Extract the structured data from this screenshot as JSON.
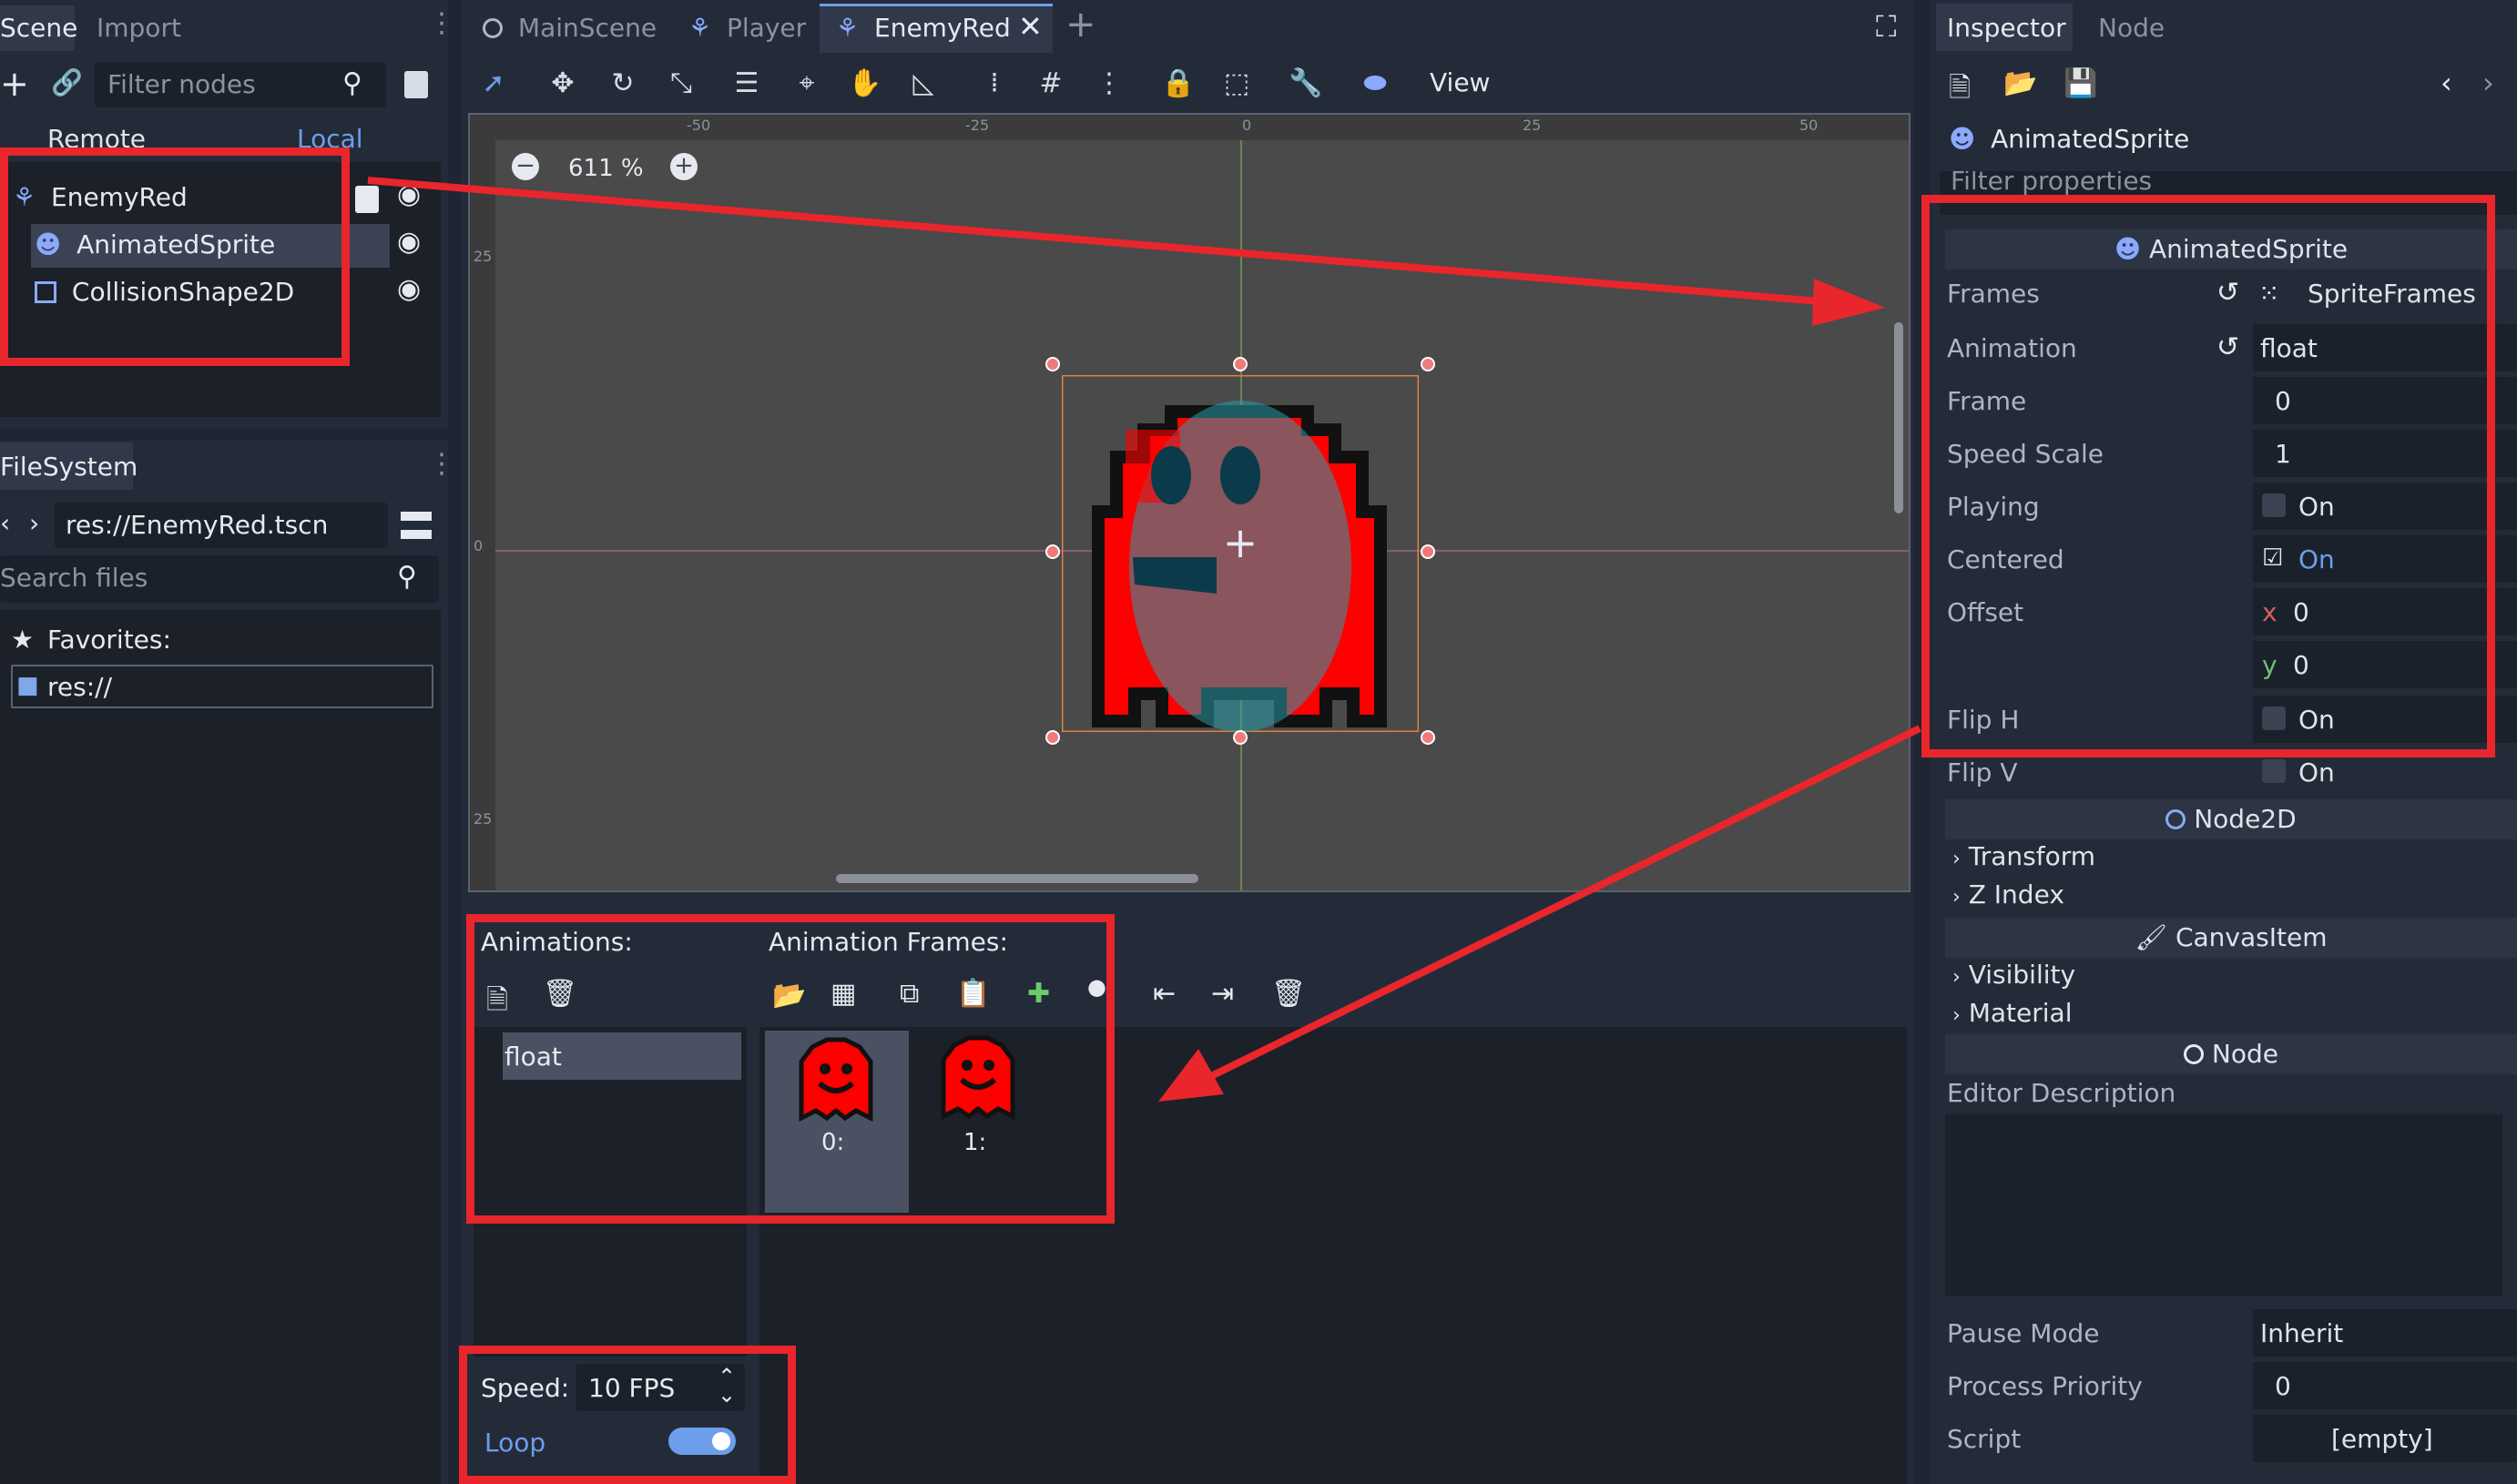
{
  "scene_dock": {
    "tabs": [
      "Scene",
      "Import"
    ],
    "filter_placeholder": "Filter nodes",
    "remote_label": "Remote",
    "local_label": "Local",
    "tree": [
      {
        "label": "EnemyRed"
      },
      {
        "label": "AnimatedSprite"
      },
      {
        "label": "CollisionShape2D"
      }
    ]
  },
  "filesystem": {
    "tab": "FileSystem",
    "path": "res://EnemyRed.tscn",
    "search_placeholder": "Search files",
    "favorites_label": "Favorites:",
    "root_label": "res://"
  },
  "editor_tabs": [
    "MainScene",
    "Player",
    "EnemyRed"
  ],
  "toolbar": {
    "view_label": "View"
  },
  "viewport": {
    "zoom": "611 %",
    "ruler_top": [
      "-50",
      "-25",
      "0",
      "25",
      "50"
    ],
    "ruler_left": [
      "25",
      "0",
      "25"
    ]
  },
  "animation_panel": {
    "animations_label": "Animations:",
    "frames_label": "Animation Frames:",
    "animations": [
      "float"
    ],
    "frames": [
      "0:",
      "1:"
    ],
    "speed_label": "Speed:",
    "speed_value": "10 FPS",
    "loop_label": "Loop",
    "loop_on": true
  },
  "inspector": {
    "tabs": [
      "Inspector",
      "Node"
    ],
    "object_title": "AnimatedSprite",
    "filter_placeholder": "Filter properties",
    "class_section": "AnimatedSprite",
    "props": [
      {
        "label": "Frames",
        "value": "SpriteFrames"
      },
      {
        "label": "Animation",
        "value": "float"
      },
      {
        "label": "Frame",
        "value": "0"
      },
      {
        "label": "Speed Scale",
        "value": "1"
      },
      {
        "label": "Playing",
        "value": "On"
      },
      {
        "label": "Centered",
        "value": "On"
      },
      {
        "label": "Offset",
        "x_label": "x",
        "x_value": "0",
        "y_label": "y",
        "y_value": "0"
      },
      {
        "label": "Flip H",
        "value": "On"
      },
      {
        "label": "Flip V",
        "value": "On"
      }
    ],
    "node2d_section": "Node2D",
    "node2d_folds": [
      "Transform",
      "Z Index"
    ],
    "canvas_section": "CanvasItem",
    "canvas_folds": [
      "Visibility",
      "Material"
    ],
    "node_section": "Node",
    "editor_description": "Editor Description",
    "pause_mode": {
      "label": "Pause Mode",
      "value": "Inherit"
    },
    "process_priority": {
      "label": "Process Priority",
      "value": "0"
    },
    "script": {
      "label": "Script",
      "value": "[empty]"
    }
  },
  "colors": {
    "annotation": "#e8262b",
    "accent": "#6d9eeb",
    "sprite": "#ff0000"
  }
}
